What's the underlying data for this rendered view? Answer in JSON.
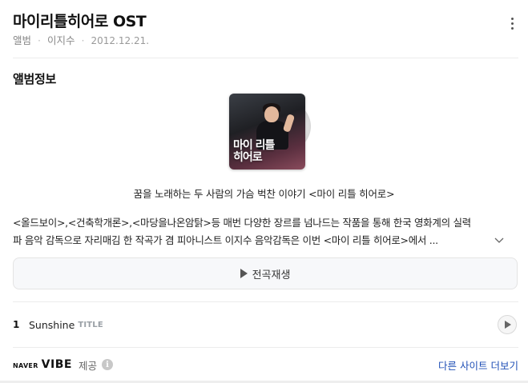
{
  "header": {
    "title": "마이리틀히어로 OST",
    "type": "앨범",
    "artist": "이지수",
    "date": "2012.12.21."
  },
  "section": {
    "title": "앨범정보"
  },
  "cover": {
    "text_line1": "마이 리틀",
    "text_line2": "히어로"
  },
  "album": {
    "tagline": "꿈을 노래하는 두 사람의 가슴 벅찬 이야기 <마이 리틀 히어로>",
    "description_line1": "<올드보이>,<건축학개론>,<마당을나온암탉>등 매번 다양한 장르를 넘나드는 작품을 통해 한국 영화계의 실력",
    "description_line2": "파 음악 감독으로 자리매김 한 작곡가 겸 피아니스트 이지수 음악감독은 이번 <마이 리틀 히어로>에서 ..."
  },
  "actions": {
    "play_all_label": "전곡재생"
  },
  "tracks": [
    {
      "number": "1",
      "name": "Sunshine",
      "badge": "TITLE"
    }
  ],
  "footer": {
    "brand_naver": "NAVER",
    "brand_vibe": "VIBE",
    "provided_label": "제공",
    "info_glyph": "i",
    "more_sites_label": "다른 사이트 더보기"
  },
  "colors": {
    "link": "#1f4fb6",
    "muted": "#888888",
    "border": "#e4e4e4"
  }
}
